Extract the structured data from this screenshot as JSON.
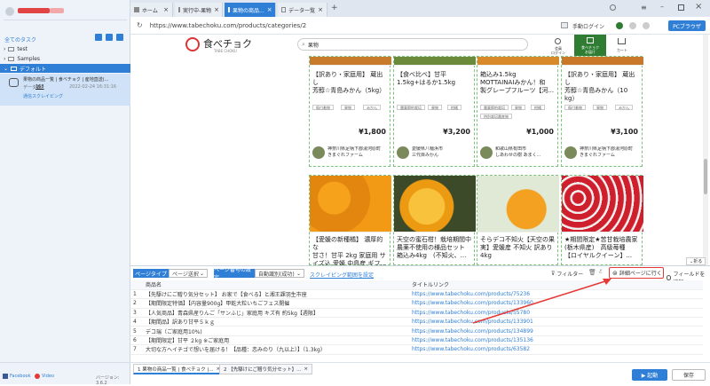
{
  "sidebar": {
    "user_name_redacted": "",
    "all_tasks": "全てのタスク",
    "folders": [
      {
        "label": "test"
      },
      {
        "label": "Samples"
      },
      {
        "label": "デフォルト"
      }
    ],
    "task": {
      "title": "果物の商品一覧 | 食べチョク | 産地直送(...",
      "data_label": "データ数:",
      "data_count": "168",
      "timestamp": "2022-02-24 16:31:16",
      "status": "通信スクレイピング"
    },
    "footer": {
      "facebook": "Facebook",
      "video": "Video",
      "version": "バージョン: 3.6.2"
    }
  },
  "browser": {
    "tabs": [
      {
        "label": "ホーム"
      },
      {
        "label": "実行中-果物"
      },
      {
        "label": "果物の商品..."
      },
      {
        "label": "データ一覧"
      }
    ],
    "url": "https://www.tabechoku.com/products/categories/2",
    "login_label": "手動ログイン",
    "pc_browser": "PCブラウザ"
  },
  "site": {
    "logo_text": "食べチョク",
    "logo_sub": "TABE CHOKU",
    "search_value": "果物",
    "header_icons": [
      {
        "label": "会員\nログイン"
      },
      {
        "label": "食べチョク\nお届け"
      },
      {
        "label": "カート"
      }
    ],
    "rows": [
      [
        {
          "title": "【訳あり・家庭用】 蔵出し\n芳醇☆青島みかん（5kg）",
          "chips": [
            "傷付着物",
            "果物",
            "みかん"
          ],
          "price": "¥1,800",
          "farm1": "神奈川県足柄下郡湯河原町",
          "farm2": "きまぐれファーム"
        },
        {
          "title": "【食べ比べ】甘平\n1.5kg+はるか1.5kg",
          "chips": [
            "農薬節約栽培",
            "果物",
            "柑橘"
          ],
          "price": "¥3,200",
          "farm1": "愛媛県八幡浜市",
          "farm2": "三代目みかん"
        },
        {
          "title": "箱込み1.5kg\nMOTTAINAIみかん！和\n製グレープフルーツ【河...",
          "chips": [
            "農薬節約栽培",
            "果物",
            "柑橘"
          ],
          "price": "¥1,000",
          "farm1": "和歌山県有田市",
          "farm2": "しあわせの樹 あまく...",
          "extra_chip": "特別栽培農産物"
        },
        {
          "title": "【訳あり・家庭用】 蔵出し\n芳醇☆青島みかん（10\nkg）",
          "chips": [
            "傷付着物",
            "果物",
            "みかん"
          ],
          "price": "¥3,100",
          "farm1": "神奈川県足柄下郡湯河原町",
          "farm2": "きまぐれファーム"
        }
      ],
      [
        {
          "title": "【愛媛の新種橘】 濃厚的な\n甘さ！甘平 2kg 家庭用 サ\nイズ込 愛媛 中島産 ギフ...",
          "price": "",
          "farm1": "",
          "farm2": ""
        },
        {
          "title": "天空の蜜石柑！栽培期間中\n農薬不使用の様品セット\n箱込み4kg　(不知火、...",
          "price": "",
          "farm1": "",
          "farm2": ""
        },
        {
          "title": "そらデコ不知火【天空の果\n実】愛媛産 不知火 訳あり\n4kg",
          "price": "",
          "farm1": "",
          "farm2": ""
        },
        {
          "title": "★期間限定★苦甘栽培農家\n(栃木県産)　高級苺種\n【ロイヤルクイーン】...",
          "price": "",
          "farm1": "",
          "farm2": ""
        }
      ]
    ]
  },
  "panel": {
    "page_type_label": "ページタイプ",
    "page_type_value": "ページ送択",
    "page_num_label": "ページ番号の設定",
    "page_num_value": "自動識別(成功)",
    "scraping_range": "スクレイピング範囲を設定",
    "filter": "フィルター",
    "detail_btn": "詳細ページに行く",
    "add_field": "フィールドを追加",
    "collapse": "折る",
    "columns": [
      "商品名",
      "タイトルリンク"
    ],
    "rows": [
      {
        "num": "1",
        "name": "【先駆けにご贈り気分セット】 お家で【食べる】と湘王課羽生市座",
        "link": "https://www.tabechoku.com/products/75236"
      },
      {
        "num": "2",
        "name": "【期間限定特価】【内容量900g】甲乾大粒いちごフェス開催",
        "link": "https://www.tabechoku.com/products/133960"
      },
      {
        "num": "3",
        "name": "【人気商品】青森県産りんご「サンふじ」家庭用 キズ有 約5kg【週限】",
        "link": "https://www.tabechoku.com/products/55780"
      },
      {
        "num": "4",
        "name": "【期間品】訳あり甘平５ｋｇ",
        "link": "https://www.tabechoku.com/products/133901"
      },
      {
        "num": "5",
        "name": "デコ瑞（ご家庭用10%)",
        "link": "https://www.tabechoku.com/products/134899"
      },
      {
        "num": "6",
        "name": "【期間限定】甘平 ２kg ※ご家庭用",
        "link": "https://www.tabechoku.com/products/135136"
      },
      {
        "num": "7",
        "name": "大切な方へイチゴで想いを届ける！【品種：恋みのり（九以上）】（1.3kg）",
        "link": "https://www.tabechoku.com/products/63582"
      }
    ],
    "bottom_tabs": [
      {
        "label": "1 果物の商品一覧 | 食べチョク |..."
      },
      {
        "label": "2 【先駆けにご贈り気分セット】..."
      }
    ],
    "run_btn": "▶ 起動",
    "save_btn": "保存"
  },
  "colors": {
    "accent": "#2f7fd6",
    "red": "#e53935",
    "green_dash": "#7cc27c"
  }
}
